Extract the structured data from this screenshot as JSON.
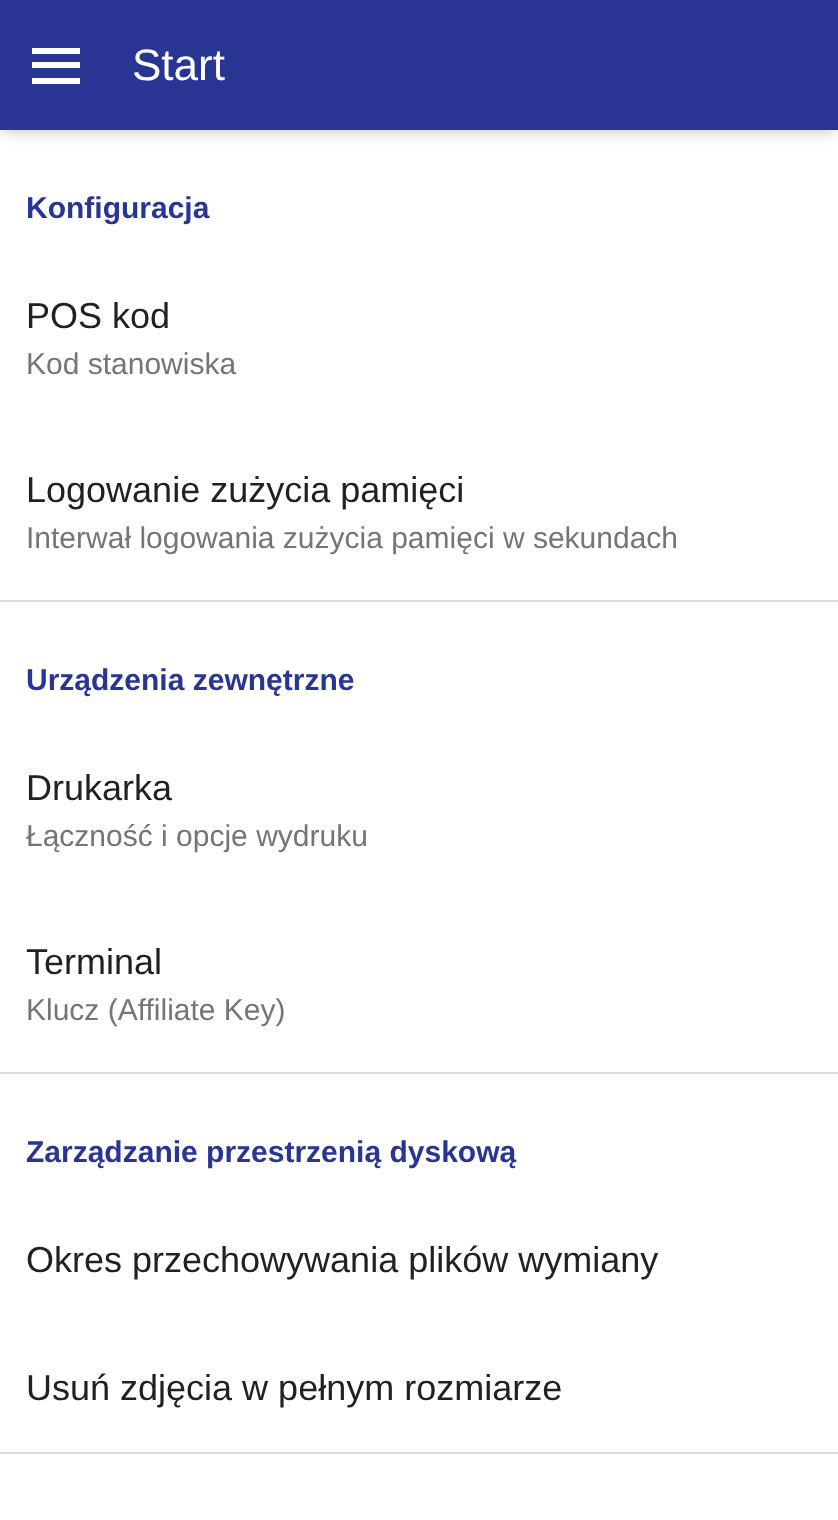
{
  "app_bar": {
    "title": "Start"
  },
  "sections": [
    {
      "heading": "Konfiguracja",
      "items": [
        {
          "title": "POS kod",
          "subtitle": "Kod stanowiska"
        },
        {
          "title": "Logowanie zużycia pamięci",
          "subtitle": "Interwał logowania zużycia pamięci w sekundach"
        }
      ]
    },
    {
      "heading": "Urządzenia zewnętrzne",
      "items": [
        {
          "title": "Drukarka",
          "subtitle": "Łączność i opcje wydruku"
        },
        {
          "title": "Terminal",
          "subtitle": "Klucz (Affiliate Key)"
        }
      ]
    },
    {
      "heading": "Zarządzanie przestrzenią dyskową",
      "items": [
        {
          "title": "Okres przechowywania plików wymiany"
        },
        {
          "title": "Usuń zdjęcia w pełnym rozmiarze"
        }
      ]
    }
  ]
}
